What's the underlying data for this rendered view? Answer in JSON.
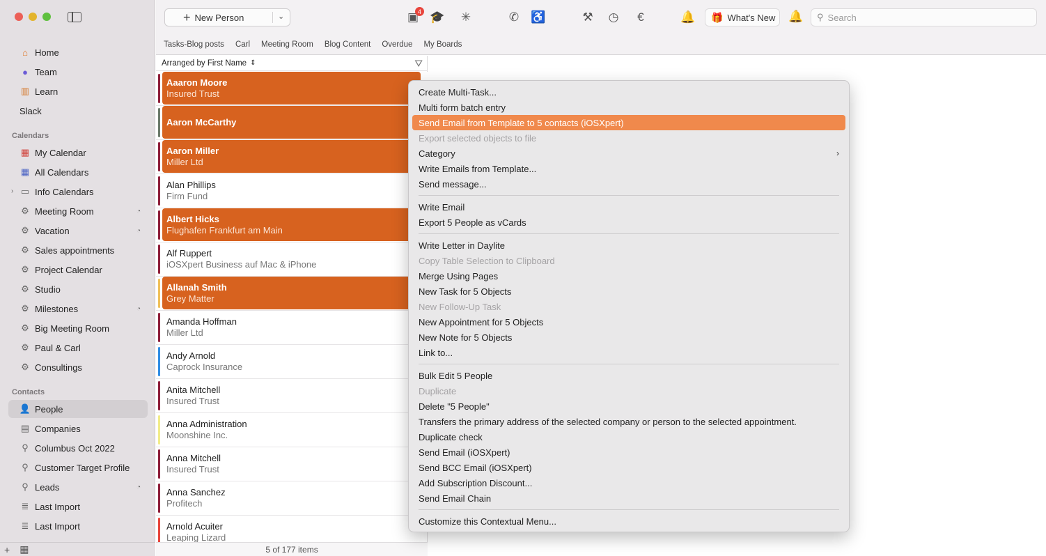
{
  "toolbar": {
    "new_person": "New Person",
    "badge_count": "4",
    "whats_new": "What's New",
    "search_placeholder": "Search"
  },
  "tabs": [
    "Tasks-Blog posts",
    "Carl",
    "Meeting Room",
    "Blog Content",
    "Overdue",
    "My Boards"
  ],
  "sidebar": {
    "nav": [
      "Home",
      "Team",
      "Learn",
      "Slack"
    ],
    "calendars_header": "Calendars",
    "calendars": [
      "My Calendar",
      "All Calendars",
      "Info Calendars",
      "Meeting Room",
      "Vacation",
      "Sales appointments",
      "Project Calendar",
      "Studio",
      "Milestones",
      "Big Meeting Room",
      "Paul & Carl",
      "Consultings"
    ],
    "contacts_header": "Contacts",
    "contacts": [
      "People",
      "Companies",
      "Columbus Oct 2022",
      "Customer Target Profile",
      "Leads",
      "Last Import",
      "Last Import"
    ]
  },
  "list": {
    "arranged_by": "Arranged by First Name",
    "status": "5 of 177 items",
    "rows": [
      {
        "name": "Aaaron Moore",
        "sub": "Insured Trust",
        "color": "#8e1e3a",
        "selected": true
      },
      {
        "name": "Aaron McCarthy",
        "sub": "",
        "color": "#6b7a6b",
        "selected": true
      },
      {
        "name": "Aaron Miller",
        "sub": "Miller Ltd",
        "color": "#8e1e3a",
        "selected": true
      },
      {
        "name": "Alan Phillips",
        "sub": "Firm Fund",
        "color": "#8e1e3a",
        "selected": false
      },
      {
        "name": "Albert Hicks",
        "sub": "Flughafen Frankfurt am Main",
        "color": "#8e1e3a",
        "selected": true
      },
      {
        "name": "Alf Ruppert",
        "sub": "iOSXpert Business auf Mac & iPhone",
        "color": "#8e1e3a",
        "selected": false
      },
      {
        "name": "Allanah Smith",
        "sub": "Grey Matter",
        "color": "#f0c05a",
        "selected": true
      },
      {
        "name": "Amanda Hoffman",
        "sub": "Miller Ltd",
        "color": "#8e1e3a",
        "selected": false
      },
      {
        "name": "Andy Arnold",
        "sub": "Caprock Insurance",
        "color": "#2f8de4",
        "selected": false
      },
      {
        "name": "Anita Mitchell",
        "sub": "Insured Trust",
        "color": "#8e1e3a",
        "selected": false
      },
      {
        "name": "Anna Administration",
        "sub": "Moonshine Inc.",
        "color": "#f2ec8a",
        "selected": false
      },
      {
        "name": "Anna Mitchell",
        "sub": "Insured Trust",
        "color": "#8e1e3a",
        "selected": false
      },
      {
        "name": "Anna Sanchez",
        "sub": "Profitech",
        "color": "#8e1e3a",
        "selected": false
      },
      {
        "name": "Arnold Acuiter",
        "sub": "Leaping Lizard",
        "color": "#e8453c",
        "selected": false
      }
    ]
  },
  "menu": {
    "items": [
      {
        "label": "Create Multi-Task...",
        "state": "normal"
      },
      {
        "label": "Multi form batch entry",
        "state": "normal"
      },
      {
        "label": "Send Email from Template to 5 contacts (iOSXpert)",
        "state": "highlighted"
      },
      {
        "label": "Export selected objects to file",
        "state": "disabled"
      },
      {
        "label": "Category",
        "state": "submenu"
      },
      {
        "label": "Write Emails from Template...",
        "state": "normal"
      },
      {
        "label": "Send message...",
        "state": "normal"
      },
      {
        "label": "Write Email",
        "state": "normal"
      },
      {
        "label": "Export 5 People as vCards",
        "state": "normal"
      },
      {
        "label": "Write Letter in Daylite",
        "state": "normal"
      },
      {
        "label": "Copy Table Selection to Clipboard",
        "state": "disabled"
      },
      {
        "label": "Merge Using Pages",
        "state": "normal"
      },
      {
        "label": "New Task for 5 Objects",
        "state": "normal"
      },
      {
        "label": "New Follow-Up Task",
        "state": "disabled"
      },
      {
        "label": "New Appointment for 5 Objects",
        "state": "normal"
      },
      {
        "label": "New Note for 5 Objects",
        "state": "normal"
      },
      {
        "label": "Link to...",
        "state": "normal"
      },
      {
        "label": "Bulk Edit 5 People",
        "state": "normal"
      },
      {
        "label": "Duplicate",
        "state": "disabled"
      },
      {
        "label": "Delete \"5 People\"",
        "state": "normal"
      },
      {
        "label": "Transfers the primary address of the selected company or person to the selected appointment.",
        "state": "normal"
      },
      {
        "label": "Duplicate check",
        "state": "normal"
      },
      {
        "label": "Send Email (iOSXpert)",
        "state": "normal"
      },
      {
        "label": "Send BCC Email (iOSXpert)",
        "state": "normal"
      },
      {
        "label": "Add Subscription Discount...",
        "state": "normal"
      },
      {
        "label": "Send Email Chain",
        "state": "normal"
      },
      {
        "label": "Customize this Contextual Menu...",
        "state": "normal"
      }
    ]
  },
  "colors": {
    "accent": "#d7621f",
    "highlight": "#f0894c"
  }
}
